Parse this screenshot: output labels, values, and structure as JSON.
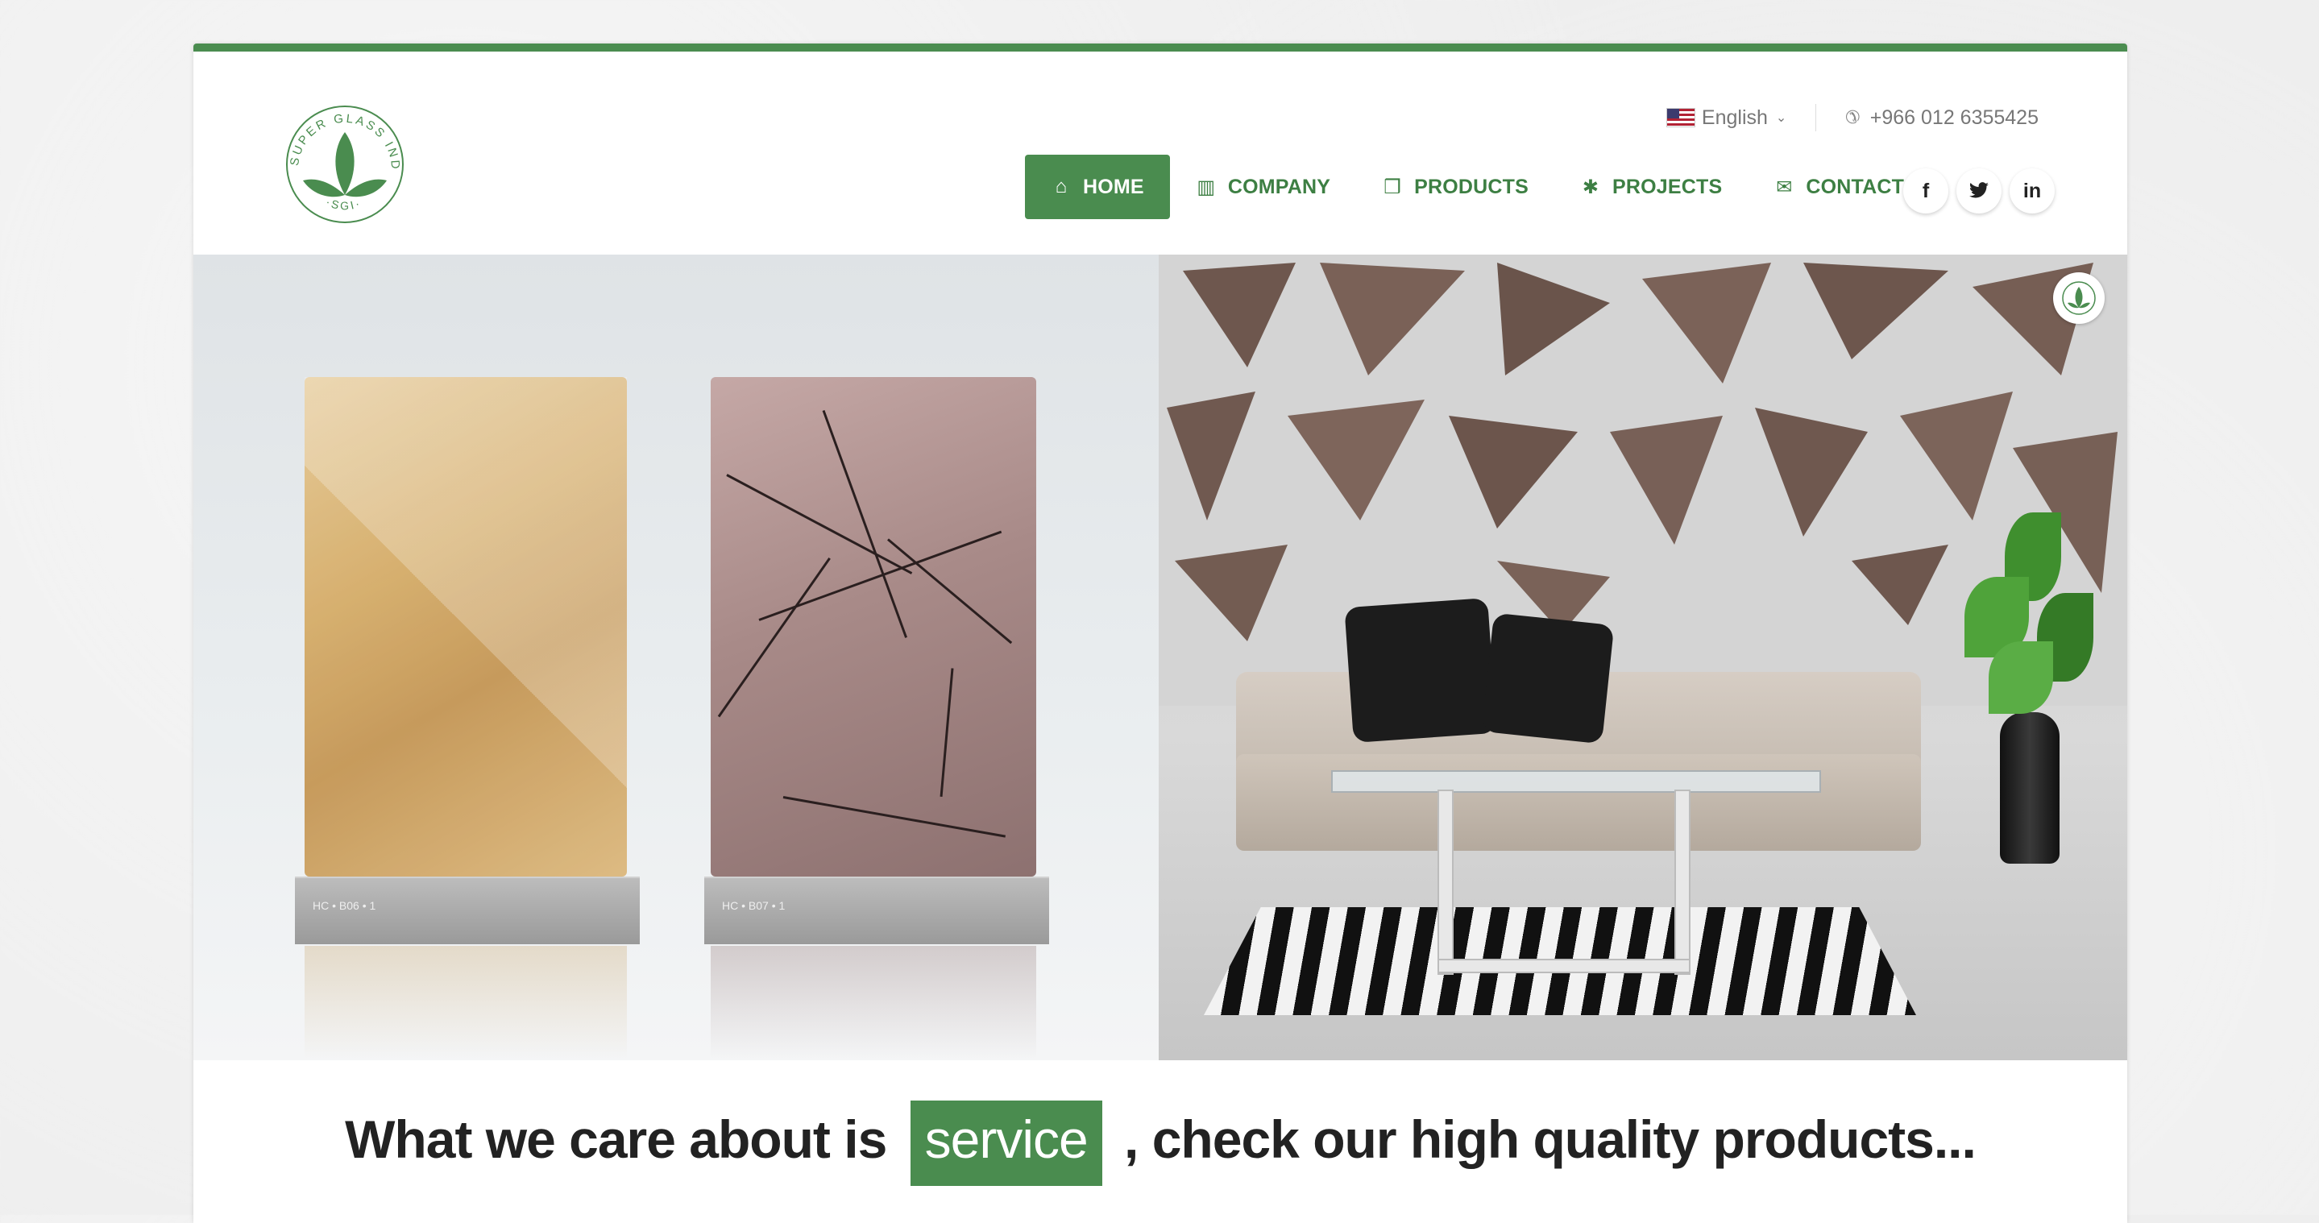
{
  "brand": {
    "logo_text": "SUPER GLASS INDUSTRY",
    "logo_abbr": "·SGI·",
    "accent_color": "#4a8c4f"
  },
  "topbar": {
    "language": "English",
    "phone": "+966 012 6355425",
    "phone_icon": "phone-icon",
    "flag_icon": "us-flag-icon"
  },
  "nav": {
    "items": [
      {
        "label": "HOME",
        "icon": "home-icon",
        "glyph": "⌂",
        "active": true
      },
      {
        "label": "COMPANY",
        "icon": "building-icon",
        "glyph": "▥",
        "active": false
      },
      {
        "label": "PRODUCTS",
        "icon": "cubes-icon",
        "glyph": "❒",
        "active": false
      },
      {
        "label": "PROJECTS",
        "icon": "gear-icon",
        "glyph": "✱",
        "active": false
      },
      {
        "label": "CONTACT",
        "icon": "envelope-icon",
        "glyph": "✉",
        "active": false
      }
    ]
  },
  "social": [
    {
      "name": "facebook-icon",
      "glyph": "f"
    },
    {
      "name": "twitter-icon",
      "glyph": "🐦"
    },
    {
      "name": "linkedin-icon",
      "glyph": "in"
    }
  ],
  "hero": {
    "panel1_code": "HC • B06 • 1",
    "panel2_code": "HC • B07 • 1"
  },
  "tagline": {
    "before": "What we care about is",
    "highlight": "service",
    "after": ", check our high quality products..."
  }
}
